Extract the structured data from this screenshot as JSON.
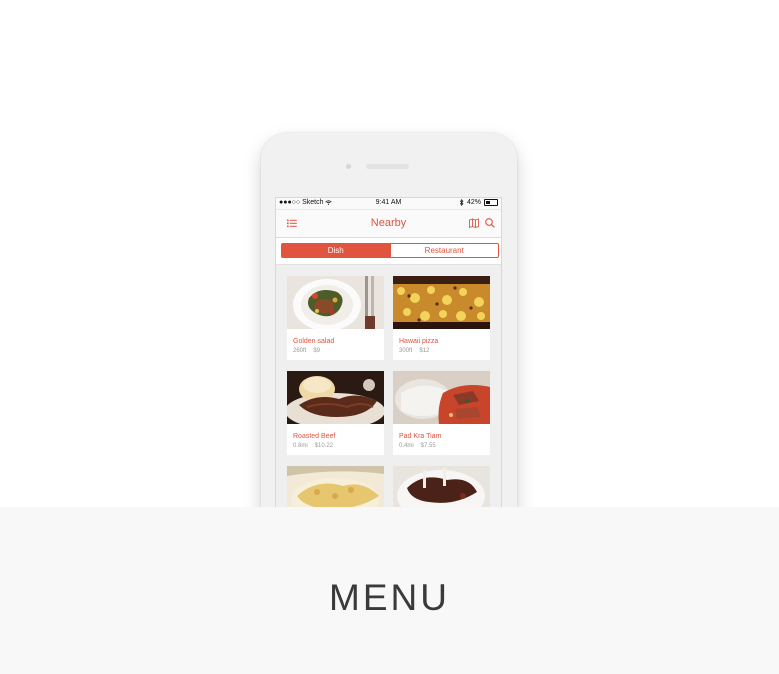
{
  "status_bar": {
    "carrier": "●●●○○ Sketch",
    "time": "9:41 AM",
    "battery": "42%"
  },
  "nav": {
    "title": "Nearby",
    "left_icon": "list-icon",
    "right_icons": [
      "map-icon",
      "search-icon"
    ]
  },
  "segments": {
    "active": "Dish",
    "inactive": "Restaurant"
  },
  "cards": [
    {
      "name": "Golden salad",
      "distance": "260ft",
      "price": "$9"
    },
    {
      "name": "Hawaii pizza",
      "distance": "300ft",
      "price": "$12"
    },
    {
      "name": "Roasted Beef",
      "distance": "0.8mi",
      "price": "$10.22"
    },
    {
      "name": "Pad Kra Tiam",
      "distance": "0.4mi",
      "price": "$7.55"
    }
  ],
  "section_label": "MENU",
  "colors": {
    "accent": "#e05440",
    "muted": "#9a9a9a",
    "band": "#f8f8f8"
  }
}
